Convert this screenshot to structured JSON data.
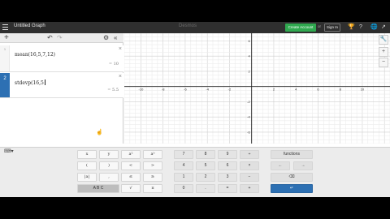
{
  "topbar": {
    "app_title": "Untitled Graph",
    "center_title": "Desmos",
    "create_account": "Create Account",
    "or": "or",
    "sign_in": "Sign In"
  },
  "expressions": [
    {
      "index": "1",
      "latex_text": "mean(16,5,7,12)",
      "result": "= 10"
    },
    {
      "index": "2",
      "latex_text": "stdevp(16,5",
      "result": "= 5.5"
    }
  ],
  "graph": {
    "x_ticks": [
      "-10",
      "-8",
      "-6",
      "-4",
      "-2",
      "2",
      "4",
      "6",
      "8",
      "10"
    ],
    "y_ticks": [
      "6",
      "4",
      "2",
      "-2",
      "-4",
      "-6"
    ],
    "x_range": [
      -11.5,
      12.5
    ],
    "y_range": [
      -7.5,
      7.0
    ],
    "grid": true
  },
  "keypad": {
    "functions_label": "functions",
    "abc_label": "A B C",
    "keys_left": [
      [
        "x",
        "y",
        "a²",
        "aᵇ"
      ],
      [
        "(",
        ")",
        "<",
        ">"
      ],
      [
        "|a|",
        ",",
        "≤",
        "≥"
      ],
      [
        "√",
        "π"
      ]
    ],
    "keys_num": [
      [
        "7",
        "8",
        "9",
        "÷"
      ],
      [
        "4",
        "5",
        "6",
        "×"
      ],
      [
        "1",
        "2",
        "3",
        "−"
      ],
      [
        "0",
        ".",
        "=",
        "+"
      ]
    ],
    "arrows": [
      "←",
      "→"
    ],
    "backspace": "⌫",
    "enter": "↵"
  },
  "icons": {
    "menu": "hamburger-icon",
    "add": "plus-icon",
    "undo": "undo-icon",
    "redo": "redo-icon",
    "settings": "gear-icon",
    "collapse": "double-chevron-left-icon",
    "keyboard": "keyboard-icon"
  }
}
